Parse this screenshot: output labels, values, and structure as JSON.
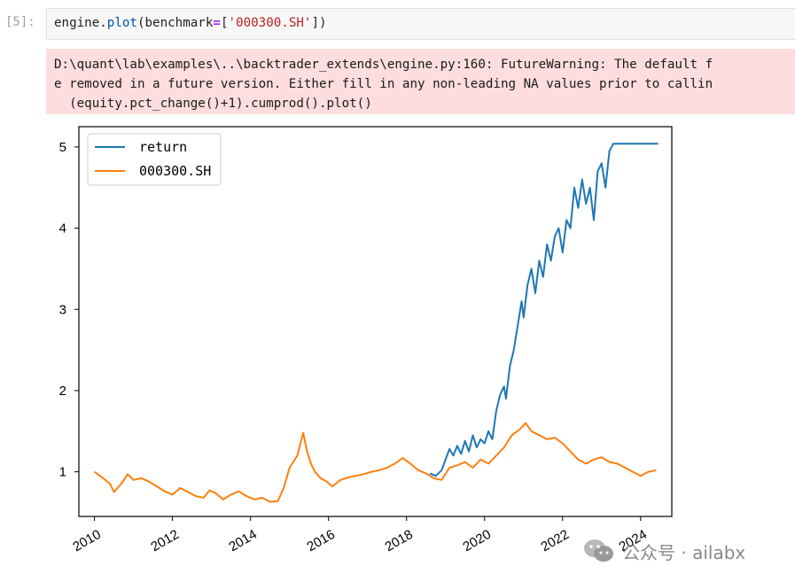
{
  "cell": {
    "prompt": "[5]:",
    "code": {
      "obj": "engine",
      "dot": ".",
      "fn": "plot",
      "open": "(",
      "kw": "benchmark",
      "eq": "=",
      "lbr": "[",
      "str": "'000300.SH'",
      "rbr": "])"
    }
  },
  "stderr": {
    "lines": [
      "D:\\quant\\lab\\examples\\..\\backtrader_extends\\engine.py:160: FutureWarning: The default f",
      "e removed in a future version. Either fill in any non-leading NA values prior to callin",
      "  (equity.pct_change()+1).cumprod().plot()"
    ]
  },
  "chart_data": {
    "type": "line",
    "title": "",
    "xlabel": "",
    "ylabel": "",
    "xlim": [
      2009.6,
      2024.8
    ],
    "ylim": [
      0.45,
      5.25
    ],
    "x_ticks": [
      2010,
      2012,
      2014,
      2016,
      2018,
      2020,
      2022,
      2024
    ],
    "x_tick_labels": [
      "2010",
      "2012",
      "2014",
      "2016",
      "2018",
      "2020",
      "2022",
      "2024"
    ],
    "y_ticks": [
      1,
      2,
      3,
      4,
      5
    ],
    "y_tick_labels": [
      "1",
      "2",
      "3",
      "4",
      "5"
    ],
    "grid": false,
    "legend_position": "upper-left",
    "series": [
      {
        "name": "return",
        "color": "#1f77b4",
        "x": [
          2018.6,
          2018.75,
          2018.9,
          2019.0,
          2019.1,
          2019.2,
          2019.3,
          2019.4,
          2019.5,
          2019.6,
          2019.7,
          2019.8,
          2019.9,
          2020.0,
          2020.1,
          2020.2,
          2020.3,
          2020.4,
          2020.5,
          2020.55,
          2020.65,
          2020.75,
          2020.85,
          2020.95,
          2021.0,
          2021.1,
          2021.2,
          2021.3,
          2021.4,
          2021.5,
          2021.6,
          2021.7,
          2021.8,
          2021.9,
          2022.0,
          2022.1,
          2022.2,
          2022.3,
          2022.4,
          2022.5,
          2022.6,
          2022.7,
          2022.8,
          2022.9,
          2023.0,
          2023.1,
          2023.2,
          2023.3,
          2023.5,
          2024.0,
          2024.45
        ],
        "y": [
          0.98,
          0.95,
          1.02,
          1.15,
          1.28,
          1.2,
          1.32,
          1.22,
          1.38,
          1.25,
          1.45,
          1.3,
          1.4,
          1.35,
          1.5,
          1.4,
          1.75,
          1.95,
          2.05,
          1.9,
          2.3,
          2.5,
          2.8,
          3.1,
          2.9,
          3.3,
          3.5,
          3.2,
          3.6,
          3.4,
          3.8,
          3.6,
          3.9,
          4.0,
          3.7,
          4.1,
          4.0,
          4.5,
          4.25,
          4.6,
          4.3,
          4.5,
          4.1,
          4.7,
          4.8,
          4.5,
          4.95,
          5.04,
          5.04,
          5.04,
          5.04
        ]
      },
      {
        "name": "000300.SH",
        "color": "#ff7f0e",
        "x": [
          2010.0,
          2010.2,
          2010.4,
          2010.5,
          2010.7,
          2010.85,
          2011.0,
          2011.2,
          2011.4,
          2011.6,
          2011.8,
          2012.0,
          2012.2,
          2012.4,
          2012.6,
          2012.8,
          2012.95,
          2013.1,
          2013.3,
          2013.5,
          2013.7,
          2013.9,
          2014.1,
          2014.3,
          2014.5,
          2014.7,
          2014.85,
          2015.0,
          2015.2,
          2015.35,
          2015.45,
          2015.55,
          2015.65,
          2015.8,
          2015.95,
          2016.1,
          2016.3,
          2016.5,
          2016.7,
          2016.9,
          2017.1,
          2017.3,
          2017.5,
          2017.7,
          2017.9,
          2018.1,
          2018.3,
          2018.5,
          2018.7,
          2018.9,
          2019.1,
          2019.3,
          2019.5,
          2019.7,
          2019.9,
          2020.1,
          2020.3,
          2020.5,
          2020.7,
          2020.9,
          2021.05,
          2021.2,
          2021.4,
          2021.6,
          2021.8,
          2022.0,
          2022.2,
          2022.4,
          2022.6,
          2022.8,
          2023.0,
          2023.2,
          2023.4,
          2023.6,
          2023.8,
          2024.0,
          2024.2,
          2024.4
        ],
        "y": [
          1.0,
          0.93,
          0.85,
          0.75,
          0.86,
          0.97,
          0.9,
          0.92,
          0.88,
          0.82,
          0.76,
          0.72,
          0.8,
          0.75,
          0.7,
          0.68,
          0.77,
          0.74,
          0.66,
          0.72,
          0.76,
          0.7,
          0.66,
          0.68,
          0.63,
          0.64,
          0.8,
          1.05,
          1.2,
          1.48,
          1.25,
          1.1,
          1.0,
          0.92,
          0.88,
          0.82,
          0.9,
          0.93,
          0.95,
          0.97,
          1.0,
          1.02,
          1.05,
          1.1,
          1.17,
          1.1,
          1.02,
          0.98,
          0.92,
          0.9,
          1.05,
          1.08,
          1.12,
          1.05,
          1.15,
          1.1,
          1.2,
          1.3,
          1.45,
          1.52,
          1.6,
          1.5,
          1.45,
          1.4,
          1.42,
          1.35,
          1.25,
          1.15,
          1.1,
          1.15,
          1.18,
          1.12,
          1.1,
          1.05,
          1.0,
          0.95,
          1.0,
          1.02
        ]
      }
    ]
  },
  "watermark": {
    "text": "公众号 · ailabx",
    "icon": "wechat-logo-icon"
  }
}
